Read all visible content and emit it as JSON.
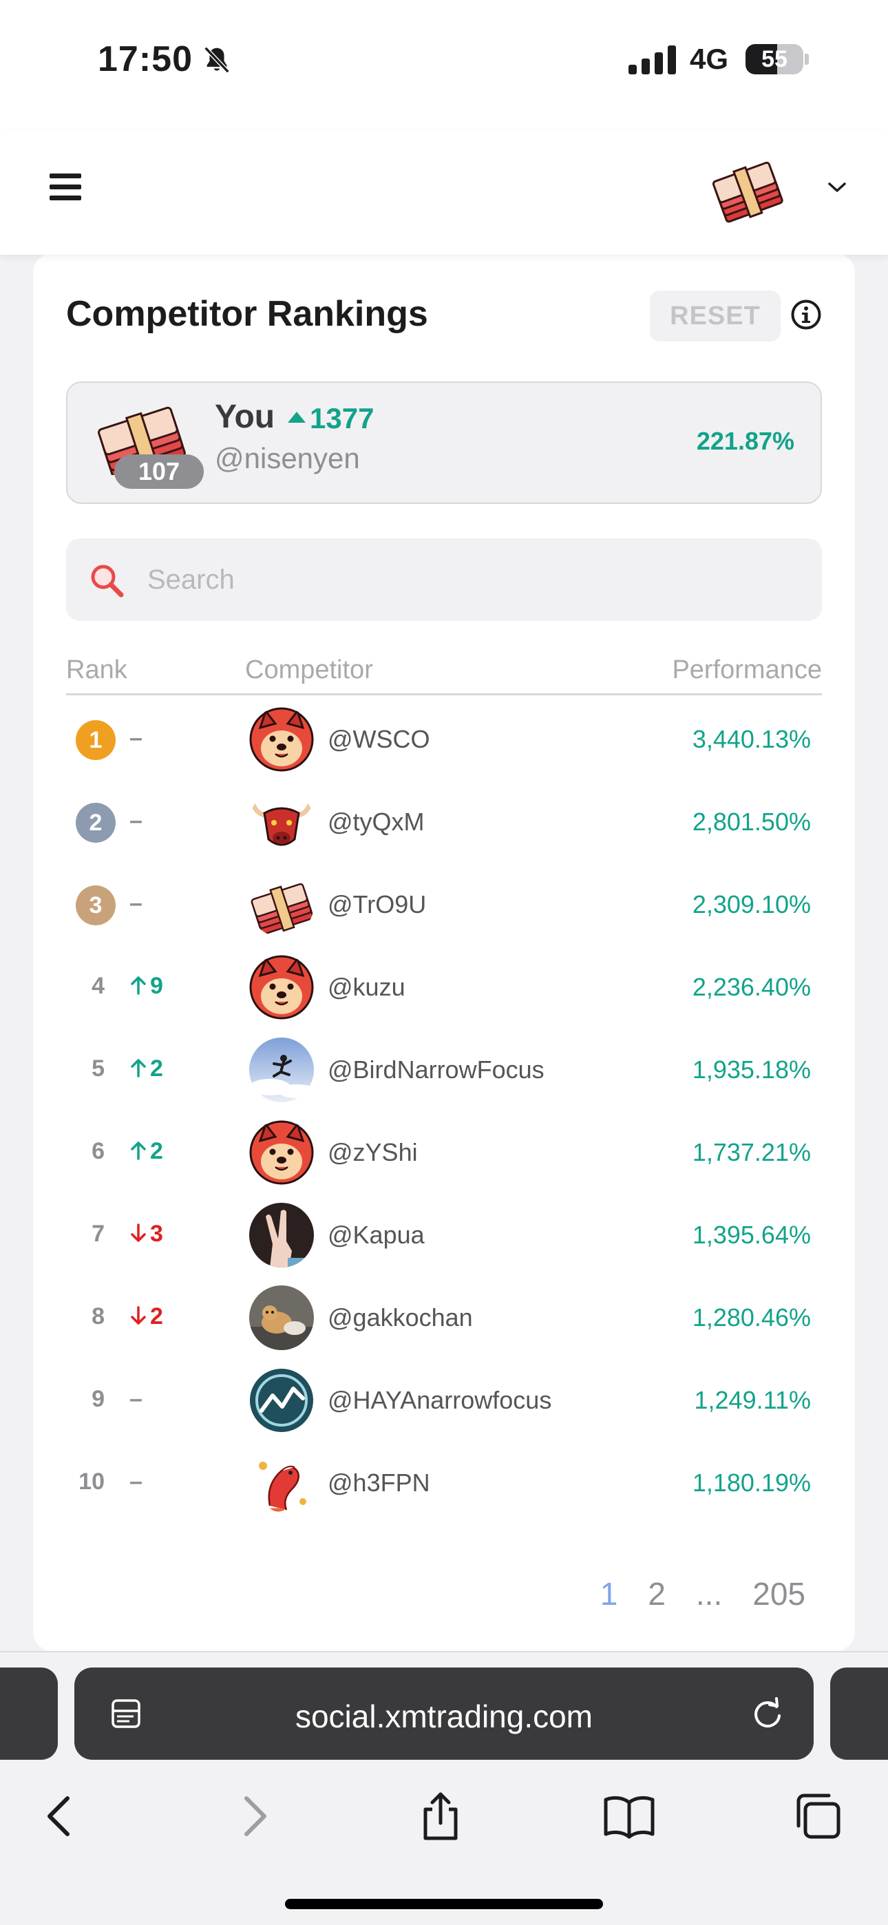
{
  "status_bar": {
    "time": "17:50",
    "network": "4G",
    "battery": "55",
    "battery_level": 0.55
  },
  "header": {
    "menu_icon": "hamburger-icon",
    "avatar_icon": "money-stack-icon",
    "dropdown_icon": "chevron-down-icon"
  },
  "rankings": {
    "title": "Competitor Rankings",
    "reset_label": "RESET",
    "info_icon": "info-icon",
    "you": {
      "name": "You",
      "rank_up": "1377",
      "handle": "@nisenyen",
      "level": "107",
      "performance": "221.87%"
    },
    "search": {
      "placeholder": "Search",
      "value": ""
    },
    "columns": {
      "rank": "Rank",
      "competitor": "Competitor",
      "performance": "Performance"
    },
    "rows": [
      {
        "rank": "1",
        "change": "–",
        "dir": "same",
        "handle": "@WSCO",
        "performance": "3,440.13%",
        "avatar": "dog"
      },
      {
        "rank": "2",
        "change": "–",
        "dir": "same",
        "handle": "@tyQxM",
        "performance": "2,801.50%",
        "avatar": "bull"
      },
      {
        "rank": "3",
        "change": "–",
        "dir": "same",
        "handle": "@TrO9U",
        "performance": "2,309.10%",
        "avatar": "money"
      },
      {
        "rank": "4",
        "change": "9",
        "dir": "up",
        "handle": "@kuzu",
        "performance": "2,236.40%",
        "avatar": "dog"
      },
      {
        "rank": "5",
        "change": "2",
        "dir": "up",
        "handle": "@BirdNarrowFocus",
        "performance": "1,935.18%",
        "avatar": "sky"
      },
      {
        "rank": "6",
        "change": "2",
        "dir": "up",
        "handle": "@zYShi",
        "performance": "1,737.21%",
        "avatar": "dog"
      },
      {
        "rank": "7",
        "change": "3",
        "dir": "down",
        "handle": "@Kapua",
        "performance": "1,395.64%",
        "avatar": "hand"
      },
      {
        "rank": "8",
        "change": "2",
        "dir": "down",
        "handle": "@gakkochan",
        "performance": "1,280.46%",
        "avatar": "cat"
      },
      {
        "rank": "9",
        "change": "–",
        "dir": "same",
        "handle": "@HAYAnarrowfocus",
        "performance": "1,249.11%",
        "avatar": "chart"
      },
      {
        "rank": "10",
        "change": "–",
        "dir": "same",
        "handle": "@h3FPN",
        "performance": "1,180.19%",
        "avatar": "koi"
      }
    ],
    "pagination": {
      "pages": [
        "1",
        "2",
        "...",
        "205"
      ],
      "current": "1"
    }
  },
  "browser": {
    "url": "social.xmtrading.com",
    "icons": [
      "page-menu-icon",
      "reload-icon",
      "back-icon",
      "forward-icon",
      "share-icon",
      "bookmarks-icon",
      "tabs-icon"
    ]
  },
  "colors": {
    "positive": "#12a38a",
    "negative": "#e02020",
    "gold": "#f0a020",
    "silver": "#8c9bb0",
    "bronze": "#c8a27a",
    "page_active": "#7fa6e6"
  }
}
